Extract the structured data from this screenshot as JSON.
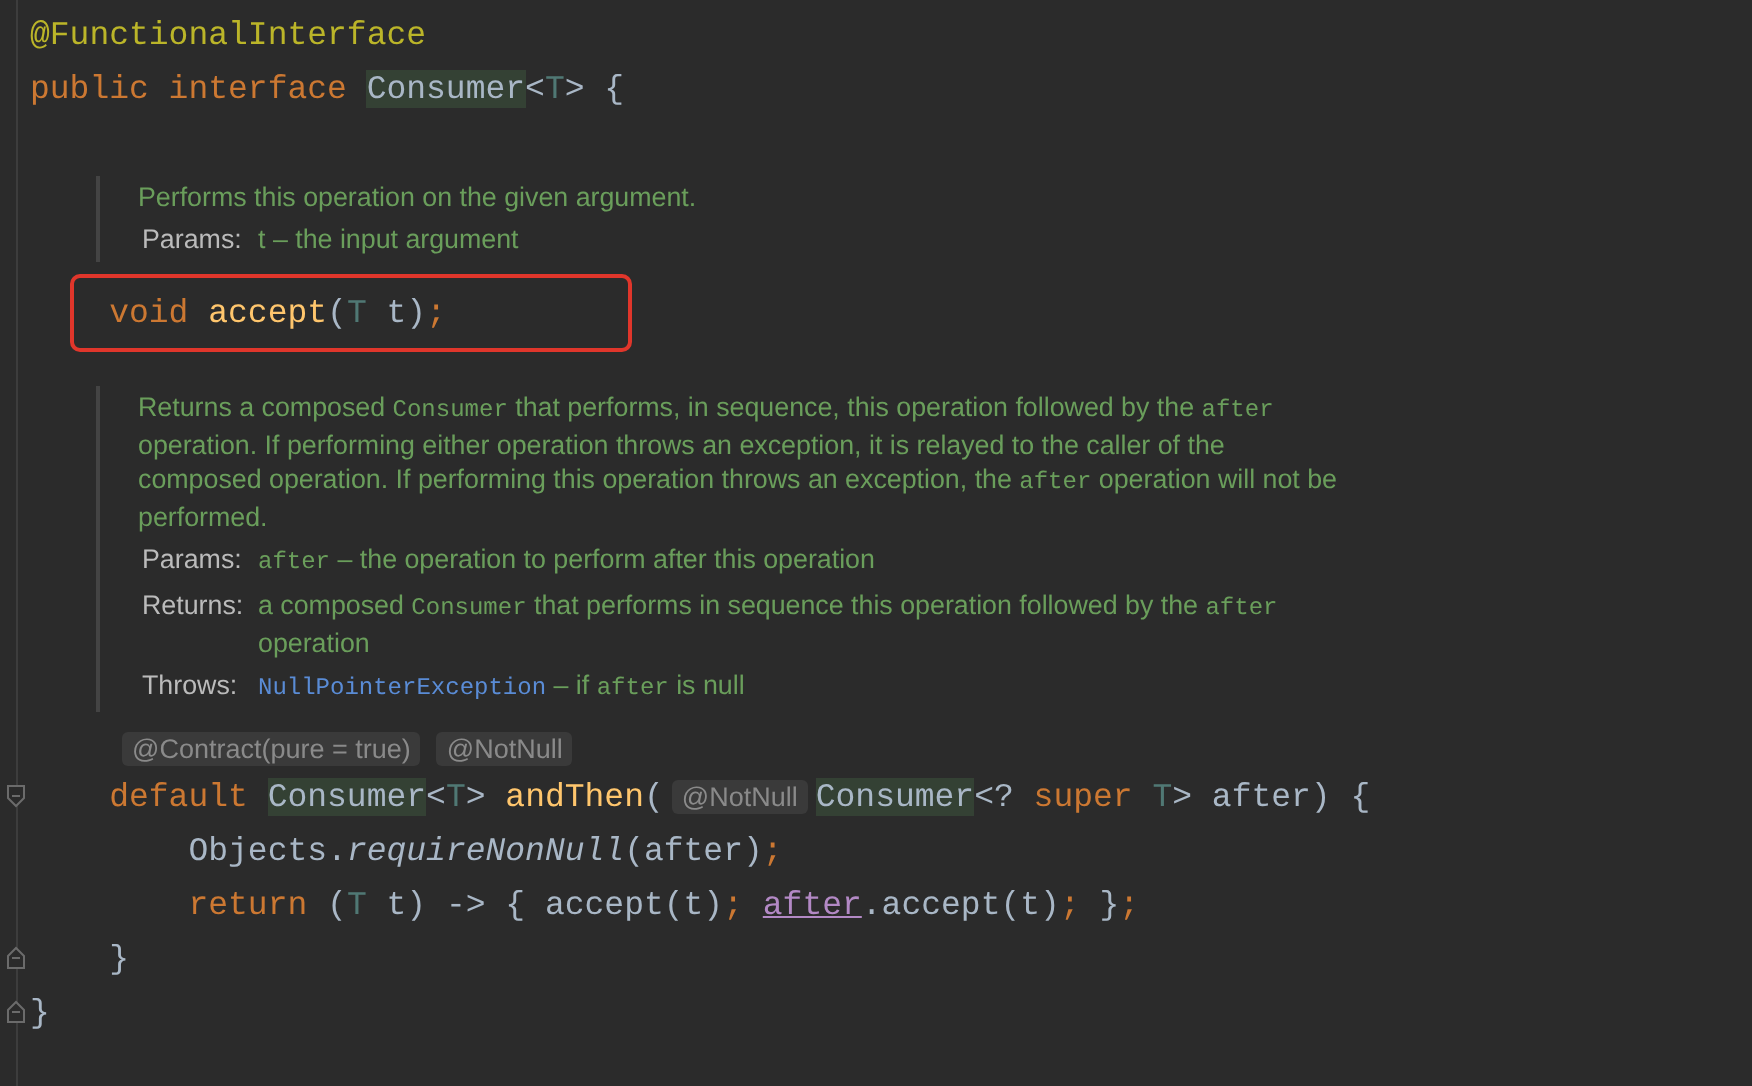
{
  "editor": {
    "blocks": [
      {
        "kind": "code",
        "parts": [
          {
            "kind": "text",
            "tokens": [
              {
                "kind": "annotation",
                "text": "@FunctionalInterface"
              }
            ]
          }
        ]
      },
      {
        "kind": "code",
        "parts": [
          {
            "kind": "text",
            "tokens": [
              {
                "kind": "keyword",
                "text": "public interface "
              },
              {
                "kind": "type-highlight",
                "text": "Consumer"
              },
              {
                "kind": "plain",
                "text": "<"
              },
              {
                "kind": "typeparam",
                "text": "T"
              },
              {
                "kind": "plain",
                "text": "> {"
              }
            ]
          }
        ]
      },
      {
        "kind": "doc",
        "paragraph": [
          {
            "kind": "prose",
            "text": "Performs this operation on the given argument."
          }
        ],
        "rows": [
          {
            "label": "Params:",
            "value": [
              {
                "kind": "prose",
                "text": "t – the input argument"
              }
            ]
          }
        ]
      },
      {
        "kind": "code",
        "boxed": true,
        "parts": [
          {
            "kind": "text",
            "tokens": [
              {
                "kind": "keyword",
                "text": "    void "
              },
              {
                "kind": "method",
                "text": "accept"
              },
              {
                "kind": "plain",
                "text": "("
              },
              {
                "kind": "typeparam",
                "text": "T"
              },
              {
                "kind": "plain",
                "text": " t)"
              },
              {
                "kind": "punct",
                "text": ";"
              }
            ]
          }
        ]
      },
      {
        "kind": "doc",
        "paragraph": [
          {
            "kind": "prose",
            "text": "Returns a composed "
          },
          {
            "kind": "code",
            "text": "Consumer"
          },
          {
            "kind": "prose",
            "text": " that performs, in sequence, this operation followed by the "
          },
          {
            "kind": "code",
            "text": "after"
          },
          {
            "kind": "prose",
            "text": " operation. If performing either operation throws an exception, it is relayed to the caller of the composed operation. If performing this operation throws an exception, the "
          },
          {
            "kind": "code",
            "text": "after"
          },
          {
            "kind": "prose",
            "text": " operation will not be performed."
          }
        ],
        "rows": [
          {
            "label": "Params:",
            "value": [
              {
                "kind": "code",
                "text": "after"
              },
              {
                "kind": "prose",
                "text": " – the operation to perform after this operation"
              }
            ]
          },
          {
            "label": "Returns:",
            "value": [
              {
                "kind": "prose",
                "text": "a composed "
              },
              {
                "kind": "code",
                "text": "Consumer"
              },
              {
                "kind": "prose",
                "text": " that performs in sequence this operation followed by the "
              },
              {
                "kind": "code",
                "text": "after"
              },
              {
                "kind": "prose",
                "text": " operation"
              }
            ]
          },
          {
            "label": "Throws:",
            "value": [
              {
                "kind": "link",
                "text": "NullPointerException"
              },
              {
                "kind": "prose",
                "text": " – if "
              },
              {
                "kind": "code",
                "text": "after"
              },
              {
                "kind": "prose",
                "text": " is null"
              }
            ]
          }
        ]
      },
      {
        "kind": "hints",
        "items": [
          "@Contract(pure = true)",
          "@NotNull"
        ]
      },
      {
        "kind": "code",
        "fold_open": true,
        "parts": [
          {
            "kind": "text",
            "tokens": [
              {
                "kind": "keyword",
                "text": "    default "
              },
              {
                "kind": "type-highlight",
                "text": "Consumer"
              },
              {
                "kind": "plain",
                "text": "<"
              },
              {
                "kind": "typeparam",
                "text": "T"
              },
              {
                "kind": "plain",
                "text": "> "
              },
              {
                "kind": "method",
                "text": "andThen"
              },
              {
                "kind": "plain",
                "text": "("
              }
            ]
          },
          {
            "kind": "inlay",
            "text": "@NotNull"
          },
          {
            "kind": "text",
            "tokens": [
              {
                "kind": "type-highlight",
                "text": "Consumer"
              },
              {
                "kind": "plain",
                "text": "<? "
              },
              {
                "kind": "keyword",
                "text": "super "
              },
              {
                "kind": "typeparam",
                "text": "T"
              },
              {
                "kind": "plain",
                "text": "> after) {"
              }
            ]
          }
        ]
      },
      {
        "kind": "code",
        "parts": [
          {
            "kind": "text",
            "tokens": [
              {
                "kind": "plain",
                "text": "        Objects."
              },
              {
                "kind": "static-call",
                "text": "requireNonNull"
              },
              {
                "kind": "plain",
                "text": "(after)"
              },
              {
                "kind": "punct",
                "text": ";"
              }
            ]
          }
        ]
      },
      {
        "kind": "code",
        "parts": [
          {
            "kind": "text",
            "tokens": [
              {
                "kind": "keyword",
                "text": "        return "
              },
              {
                "kind": "plain",
                "text": "("
              },
              {
                "kind": "typeparam",
                "text": "T"
              },
              {
                "kind": "plain",
                "text": " t) -> { accept(t)"
              },
              {
                "kind": "punct",
                "text": "; "
              },
              {
                "kind": "param-ref",
                "text": "after"
              },
              {
                "kind": "plain",
                "text": ".accept(t)"
              },
              {
                "kind": "punct",
                "text": "; "
              },
              {
                "kind": "plain",
                "text": "}"
              },
              {
                "kind": "punct",
                "text": ";"
              }
            ]
          }
        ]
      },
      {
        "kind": "code",
        "fold_close": true,
        "parts": [
          {
            "kind": "text",
            "tokens": [
              {
                "kind": "plain",
                "text": "    }"
              }
            ]
          }
        ]
      },
      {
        "kind": "code",
        "fold_close": true,
        "parts": [
          {
            "kind": "text",
            "tokens": [
              {
                "kind": "plain",
                "text": "}"
              }
            ]
          }
        ]
      }
    ]
  }
}
